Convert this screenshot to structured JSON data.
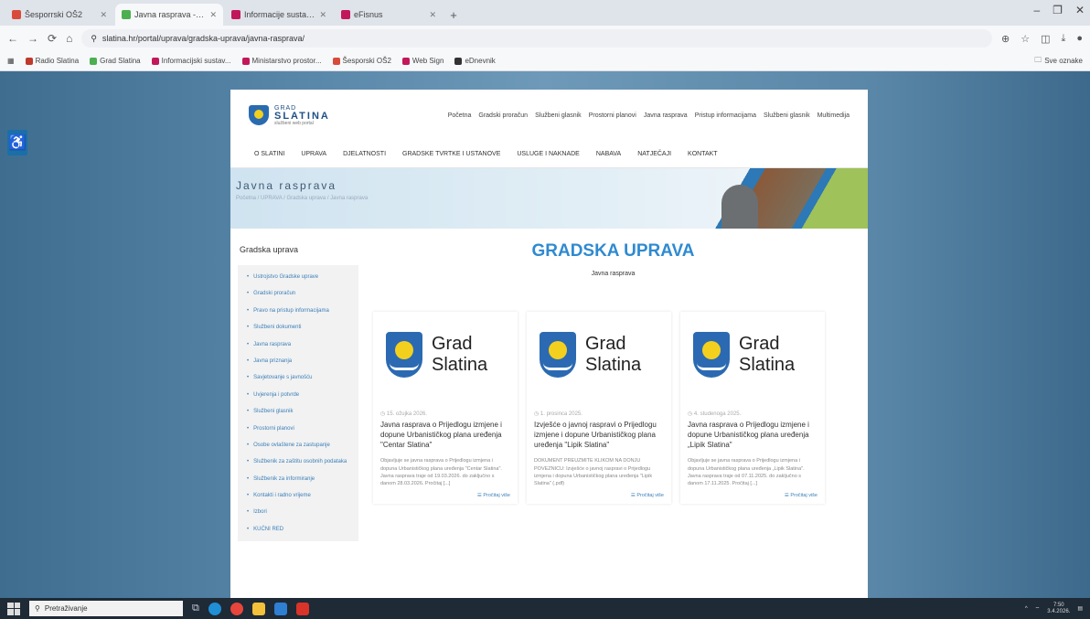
{
  "browser": {
    "tabs": [
      {
        "title": "Šesporrski OŠ2",
        "color": "#d84b3b",
        "active": false
      },
      {
        "title": "Javna rasprava - Grad Slatina",
        "color": "#4caf50",
        "active": true
      },
      {
        "title": "Informacije sustav promjena",
        "color": "#c2185b",
        "active": false
      },
      {
        "title": "eFisnus",
        "color": "#c2185b",
        "active": false
      }
    ],
    "url": "slatina.hr/portal/uprava/gradska-uprava/javna-rasprava/",
    "bookmarks": [
      "Radio Slatina",
      "Grad Slatina",
      "Informacijski sustav...",
      "Ministarstvo prostor...",
      "Šesporski OŠ2",
      "Web Sign",
      "eDnevnik"
    ],
    "right_bookmark": "Sve oznake"
  },
  "site": {
    "logo": {
      "line1": "GRAD",
      "line2": "SLATINA",
      "line3": "službeni web portal"
    },
    "top_nav": [
      "Početna",
      "Gradski proračun",
      "Službeni glasnik",
      "Prostorni planovi",
      "Javna rasprava",
      "Pristup informacijama",
      "Službeni glasnik",
      "Multimedija"
    ],
    "main_nav": [
      "O SLATINI",
      "UPRAVA",
      "DJELATNOSTI",
      "GRADSKE TVRTKE I USTANOVE",
      "USLUGE I NAKNADE",
      "NABAVA",
      "NATJEČAJI",
      "KONTAKT"
    ],
    "banner": {
      "title": "Javna rasprava",
      "breadcrumb": "Početna  /  UPRAVA  /  Gradska uprava  /  Javna rasprava"
    },
    "sidebar": {
      "title": "Gradska uprava",
      "items": [
        "Ustrojstvo Gradske uprave",
        "Gradski proračun",
        "Pravo na pristup informacijama",
        "Službeni dokumenti",
        "Javna rasprava",
        "Javna priznanja",
        "Savjetovanje s javnošću",
        "Uvjerenja i potvrde",
        "Službeni glasnik",
        "Prostorni planovi",
        "Osobe ovlaštene za zastupanje",
        "Službenik za zaštitu osobnih podataka",
        "Službenik za informiranje",
        "Kontakti i radno vrijeme",
        "Izbori",
        "KUĆNI RED"
      ]
    },
    "heading": "GRADSKA UPRAVA",
    "subheading": "Javna rasprava",
    "card_brand": [
      "Grad",
      "Slatina"
    ],
    "cards": [
      {
        "date": "15. ožujka 2026.",
        "title": "Javna rasprava o Prijedlogu izmjene i dopune Urbanističkog plana uređenja \"Centar Slatina\"",
        "excerpt": "Objavljuje se javna rasprava o Prijedlogu izmjena i dopuna Urbanističkog plana uređenja \"Centar Slatina\". Javna rasprava traje od 19.03.2026. do zaključno s danom 28.03.2026. Pročitaj [...]",
        "more": "Pročitaj više"
      },
      {
        "date": "1. prosinca 2025.",
        "title": "Izvješće o javnoj raspravi o Prijedlogu izmjene i dopune Urbanističkog plana uređenja \"Lipik Slatina\"",
        "excerpt": "DOKUMENT PREUZMITE KLIKOM NA DONJU POVEZNICU: Izvješće o javnoj raspravi o Prijedlogu izmjena i dopuna Urbanističkog plana uređenja \"Lipik Slatina\" (.pdf)",
        "more": "Pročitaj više"
      },
      {
        "date": "4. studenoga 2025.",
        "title": "Javna rasprava o Prijedlogu izmjene i dopune Urbanističkog plana uređenja „Lipik Slatina\"",
        "excerpt": "Objavljuje se javna rasprava o Prijedlogu izmjena i dopuna Urbanističkog plana uređenja „Lipik Slatina\". Javna rasprava traje od 07.11.2025. do zaključno s danom 17.11.2025. Pročitaj [...]",
        "more": "Pročitaj više"
      }
    ]
  },
  "taskbar": {
    "search_placeholder": "Pretraživanje",
    "time": "7:50",
    "date": "3.4.2026."
  }
}
